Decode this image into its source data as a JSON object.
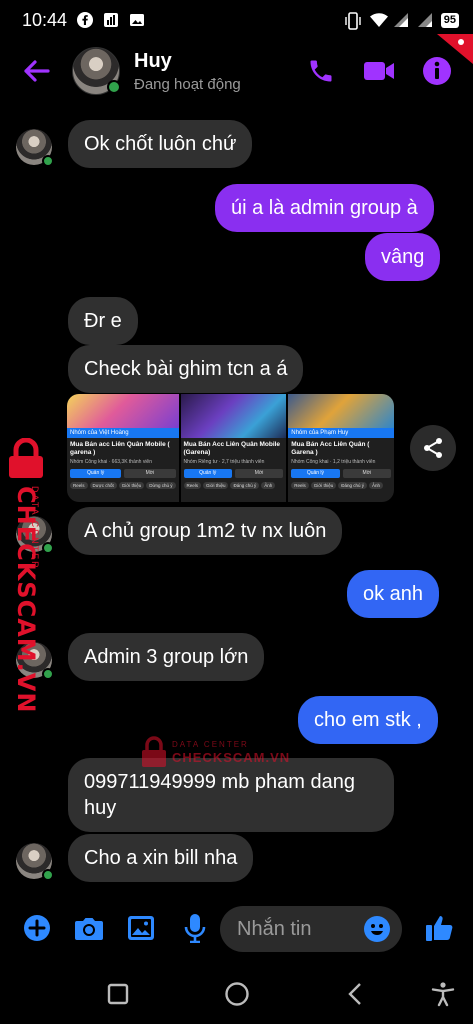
{
  "status_bar": {
    "time": "10:44",
    "battery": "95"
  },
  "header": {
    "name": "Huy",
    "status": "Đang hoạt động"
  },
  "messages": [
    {
      "text": "Ok chốt luôn chứ"
    },
    {
      "text": "úi a là admin group à"
    },
    {
      "text": "vâng"
    },
    {
      "text": "Đr e"
    },
    {
      "text": "Check bài ghim tcn a á"
    },
    {
      "text": "A chủ group 1m2 tv nx luôn"
    },
    {
      "text": "ok anh"
    },
    {
      "text": "Admin 3 group lớn"
    },
    {
      "text": "cho em stk ,"
    },
    {
      "text": "099711949999 mb pham dang huy"
    },
    {
      "text": "Cho a xin bill nha"
    }
  ],
  "link_cards": [
    {
      "group_tag": "Nhóm của Việt Hoàng",
      "title": "Mua Bán acc Liên Quân Mobile ( garena )",
      "meta": "Nhóm Công khai · 663,3K thành viên",
      "btn_primary": "Quản lý",
      "btn_secondary": "Mời",
      "chips": [
        "Reels",
        "Dược chốt",
        "Giới thiệu",
        "Dừng chú ý"
      ]
    },
    {
      "group_tag": "",
      "title": "Mua Bán Acc Liên Quân Mobile (Garena)",
      "meta": "Nhóm Riêng tư · 2,7 triệu thành viên",
      "btn_primary": "Quản lý",
      "btn_secondary": "Mời",
      "chips": [
        "Reels",
        "Giới thiệu",
        "Đáng chú ý",
        "Ảnh"
      ]
    },
    {
      "group_tag": "Nhóm của Phạm Huy",
      "title": "Mua Bán Acc Liên Quân ( Garena )",
      "meta": "Nhóm Công khai · 1,2 triệu thành viên",
      "btn_primary": "Quản lý",
      "btn_secondary": "Mời",
      "chips": [
        "Reels",
        "Giới thiệu",
        "Đáng chú ý",
        "Ảnh"
      ]
    }
  ],
  "watermark": {
    "brand": "CHECKSCAM.VN",
    "sub": "DATA CENTER",
    "brand_lower": "CHECKSCAM.VN"
  },
  "composer": {
    "placeholder": "Nhắn tin"
  },
  "colors": {
    "accent_purple": "#a033ff",
    "out_purple": "#8a2ff0",
    "out_blue": "#3266f4",
    "composer_blue": "#2e89ff",
    "watermark_red": "#e0112b"
  }
}
